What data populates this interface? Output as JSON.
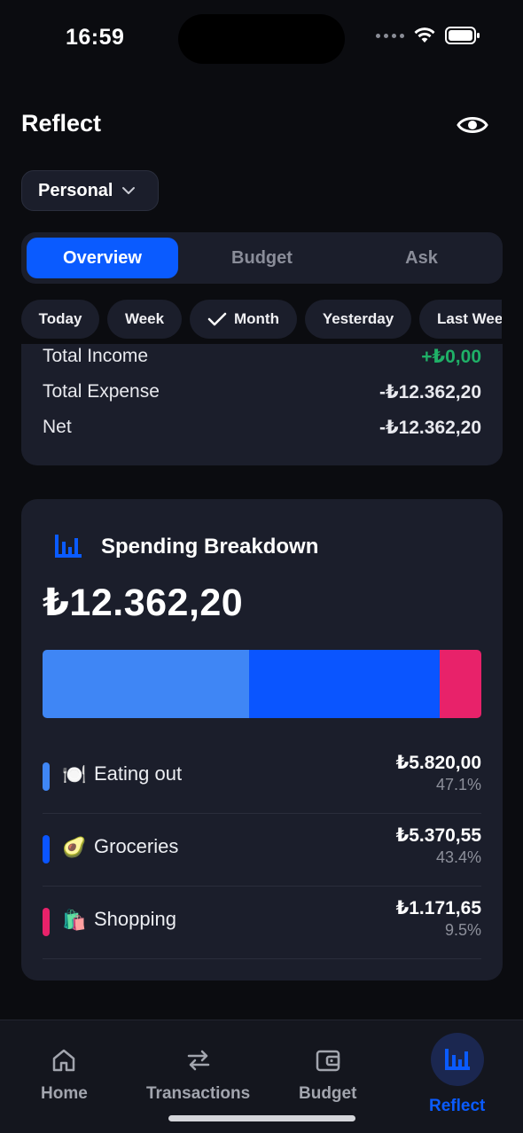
{
  "status": {
    "time": "16:59"
  },
  "header": {
    "title": "Reflect"
  },
  "account": {
    "label": "Personal"
  },
  "tabs": [
    {
      "label": "Overview",
      "active": true
    },
    {
      "label": "Budget",
      "active": false
    },
    {
      "label": "Ask",
      "active": false
    }
  ],
  "periods": [
    {
      "label": "Today"
    },
    {
      "label": "Week"
    },
    {
      "label": "Month",
      "selected": true
    },
    {
      "label": "Yesterday"
    },
    {
      "label": "Last Week"
    }
  ],
  "summary": [
    {
      "label": "Total Income",
      "value": "+₺0,00",
      "positive": true
    },
    {
      "label": "Total Expense",
      "value": "-₺12.362,20"
    },
    {
      "label": "Net",
      "value": "-₺12.362,20"
    }
  ],
  "breakdown": {
    "title": "Spending Breakdown",
    "total": "₺12.362,20",
    "categories": [
      {
        "emoji": "🍽️",
        "name": "Eating out",
        "amount": "₺5.820,00",
        "percent": "47.1%",
        "share": 0.471,
        "color": "#3f86f5"
      },
      {
        "emoji": "🥑",
        "name": "Groceries",
        "amount": "₺5.370,55",
        "percent": "43.4%",
        "share": 0.434,
        "color": "#0a55ff"
      },
      {
        "emoji": "🛍️",
        "name": "Shopping",
        "amount": "₺1.171,65",
        "percent": "9.5%",
        "share": 0.095,
        "color": "#e8226a"
      }
    ]
  },
  "bottom_nav": [
    {
      "label": "Home",
      "icon": "home-icon"
    },
    {
      "label": "Transactions",
      "icon": "transfer-icon"
    },
    {
      "label": "Budget",
      "icon": "wallet-icon"
    },
    {
      "label": "Reflect",
      "icon": "bar-chart-icon",
      "active": true
    }
  ]
}
